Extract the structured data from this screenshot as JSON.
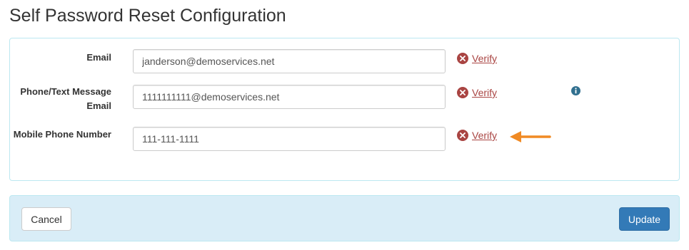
{
  "page": {
    "title": "Self Password Reset Configuration"
  },
  "fields": [
    {
      "label": "Email",
      "value": "janderson@demoservices.net",
      "verify_label": "Verify"
    },
    {
      "label": "Phone/Text Message Email",
      "value": "1111111111@demoservices.net",
      "verify_label": "Verify"
    },
    {
      "label": "Mobile Phone Number",
      "value": "111-111-1111",
      "verify_label": "Verify"
    }
  ],
  "actions": {
    "cancel_label": "Cancel",
    "update_label": "Update"
  },
  "colors": {
    "error": "#a94442",
    "info": "#31708f",
    "primary": "#337ab7",
    "arrow": "#f08a24",
    "footer_bg": "#d9edf7"
  },
  "icons": {
    "verify_status": "x-circle-icon",
    "info": "info-circle-icon",
    "annotation": "arrow-left-icon"
  }
}
